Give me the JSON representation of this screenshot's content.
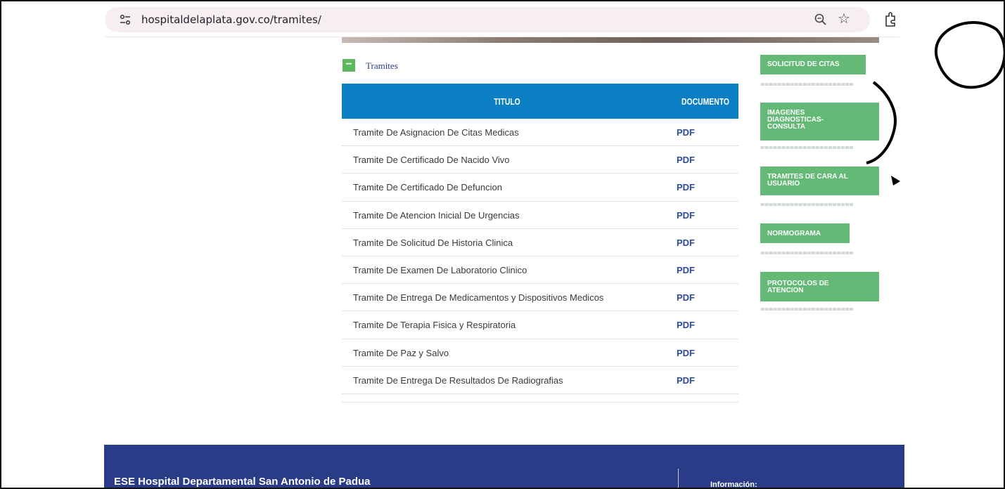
{
  "browser": {
    "url": "hospitaldelaplata.gov.co/tramites/"
  },
  "accordion": {
    "toggle_symbol": "−",
    "label": "Tramites"
  },
  "table": {
    "headers": [
      "TITULO",
      "DOCUMENTO"
    ],
    "rows": [
      {
        "title": "Tramite De Asignacion De Citas Medicas",
        "doc": "PDF"
      },
      {
        "title": "Tramite De Certificado De Nacido Vivo",
        "doc": "PDF"
      },
      {
        "title": "Tramite De Certificado De Defuncion",
        "doc": "PDF"
      },
      {
        "title": "Tramite De Atencion Inicial De Urgencias",
        "doc": "PDF"
      },
      {
        "title": "Tramite De Solicitud De Historia Clinica",
        "doc": "PDF"
      },
      {
        "title": "Tramite De Examen De Laboratorio Clinico",
        "doc": "PDF"
      },
      {
        "title": "Tramite De Entrega De Medicamentos y Dispositivos Medicos",
        "doc": "PDF"
      },
      {
        "title": "Tramite De Terapia Fisica y Respiratoria",
        "doc": "PDF"
      },
      {
        "title": "Tramite De Paz y Salvo",
        "doc": "PDF"
      },
      {
        "title": "Tramite De Entrega De Resultados De Radiografias",
        "doc": "PDF"
      }
    ]
  },
  "sidebar": {
    "separator": "======================",
    "buttons": [
      {
        "label": "SOLICITUD DE CITAS"
      },
      {
        "label": "IMAGENES DIAGNOSTICAS-CONSULTA"
      },
      {
        "label": "TRAMITES DE CARA AL USUARIO"
      },
      {
        "label": "NORMOGRAMA"
      },
      {
        "label": "PROTOCOLOS DE ATENCION"
      }
    ]
  },
  "footer": {
    "name": "ESE Hospital Departamental San Antonio de Padua",
    "info_label": "Información:"
  },
  "colors": {
    "table_header": "#0b7fc4",
    "sidebar_button": "#63b975",
    "footer": "#2a3c88",
    "toggle": "#5cb85c"
  }
}
